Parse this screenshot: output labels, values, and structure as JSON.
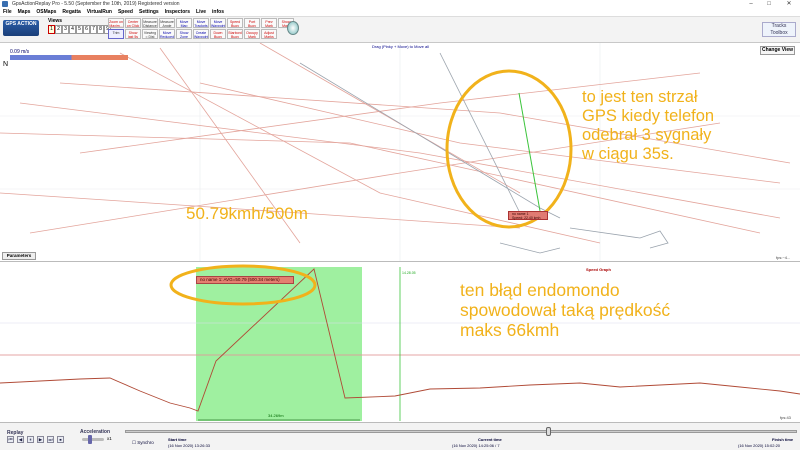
{
  "window": {
    "title": "GpsActionReplay Pro - 5.50 (September the 10th, 2019)     Registered version",
    "minimize": "–",
    "maximize": "□",
    "close": "✕"
  },
  "menu": [
    "File",
    "Maps",
    "OSMaps",
    "Regatta",
    "VirtualRun",
    "Speed",
    "Settings",
    "Inspectors",
    "Live",
    "infos"
  ],
  "toolbar": {
    "logo_text": "GPS ACTION",
    "views_label": "Views",
    "view_buttons": [
      "1",
      "2",
      "3",
      "4",
      "5",
      "6",
      "7",
      "8",
      "9"
    ],
    "buttons": [
      {
        "label": "Zoom on Maxim...",
        "style": "red"
      },
      {
        "label": "Center on Click",
        "style": "red"
      },
      {
        "label": "Measure Distance",
        "style": ""
      },
      {
        "label": "Measure Angle",
        "style": ""
      },
      {
        "label": "Move Map",
        "style": "blue"
      },
      {
        "label": "Move Trackpts",
        "style": "blue"
      },
      {
        "label": "Move Waypoint",
        "style": "blue"
      },
      {
        "label": "Speed Buoy",
        "style": "red"
      },
      {
        "label": "Port Buoy",
        "style": "red"
      },
      {
        "label": "Prev Mark",
        "style": "red"
      },
      {
        "label": "Show Mark",
        "style": "red"
      },
      {
        "label": "Trim",
        "style": "selected"
      },
      {
        "label": "Show last 5s",
        "style": "red"
      },
      {
        "label": "Viewing = Dist",
        "style": ""
      },
      {
        "label": "Move Reduced",
        "style": "blue"
      },
      {
        "label": "Show Zone",
        "style": "blue"
      },
      {
        "label": "Create Waypoint",
        "style": "blue"
      },
      {
        "label": "Down Buoy",
        "style": "red"
      },
      {
        "label": "Starbord Buoy",
        "style": "red"
      },
      {
        "label": "Occupy Mark",
        "style": "red"
      },
      {
        "label": "Adjust Marks",
        "style": "red"
      }
    ],
    "tracks_toolbox": [
      "Tracks",
      "Toolbox"
    ]
  },
  "map": {
    "speed_legend": "0.09 m/s",
    "north": "N",
    "hint": "Drag (Pinky + Move) to Move all",
    "change_view": "Change View",
    "parameters": "Parameters",
    "fps": "fps:~4...",
    "track_label_line1": "no name 1",
    "track_label_line2": "Speed: 22.40 kmh"
  },
  "graph": {
    "title": "Speed Graph",
    "avg_label": "no name 1: AVG=50.79 (500.34 meters)",
    "y_ticks_top": "14.28.05",
    "distance": "34.269m",
    "fps": "fps:43"
  },
  "bottom": {
    "replay": "Replay",
    "controls": [
      "⏮",
      "◀",
      "⏸",
      "▶",
      "⏭",
      "⏹"
    ],
    "acceleration": "Acceleration",
    "accel_value": "x1",
    "synchro": "Synchro",
    "start_label": "Start time",
    "start_time": "(16 Nov 2020) 13:26:33",
    "current_label": "Current time",
    "current_time": "(16 Nov 2020) 14:25:06 / 7",
    "finish_label": "Finish time",
    "finish_time": "(16 Nov 2020) 15:02:20"
  },
  "annotations": {
    "top_lines": [
      "to jest ten strzał",
      "GPS kiedy telefon",
      "odebrał 3 sygnały",
      "w ciągu 35s."
    ],
    "speed_text": "50.79kmh/500m",
    "bottom_lines": [
      "ten błąd endomondo",
      "spowodował taką prędkość",
      "maks 66kmh"
    ]
  },
  "colors": {
    "annotation": "#f1b21b",
    "track": "#e3a49b",
    "highlight_zone": "#9ff0a0",
    "speed_line": "#b04a36"
  }
}
